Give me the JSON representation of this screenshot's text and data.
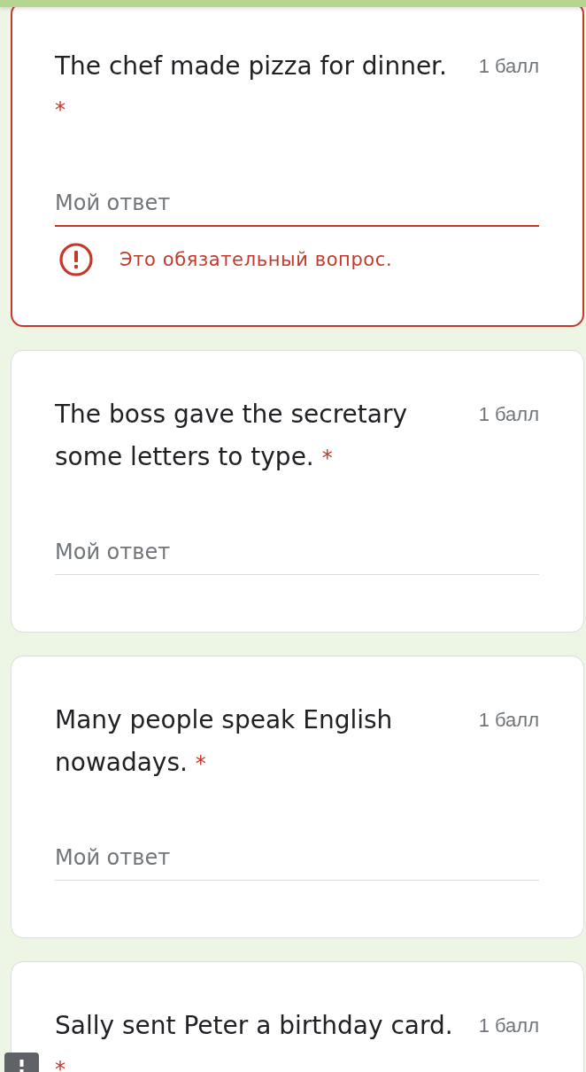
{
  "questions": [
    {
      "title": "The chef made pizza for dinner.",
      "required_mark": "*",
      "points": "1 балл",
      "answer": {
        "placeholder": "Мой ответ"
      },
      "error": "Это обязательный вопрос."
    },
    {
      "title": "The boss gave the secretary some letters to type.",
      "required_mark": "*",
      "points": "1 балл",
      "answer": {
        "placeholder": "Мой ответ"
      }
    },
    {
      "title": "Many people speak English nowadays.",
      "required_mark": "*",
      "points": "1 балл",
      "answer": {
        "placeholder": "Мой ответ"
      }
    },
    {
      "title": "Sally sent Peter a birthday card.",
      "required_mark": "*",
      "points": "1 балл"
    }
  ]
}
